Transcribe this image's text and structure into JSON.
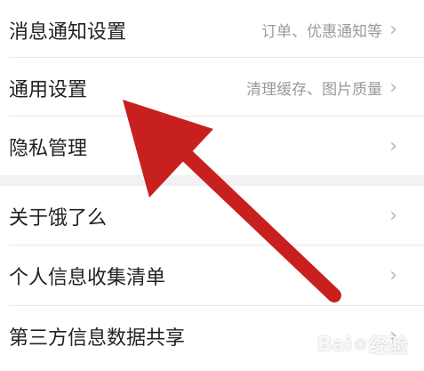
{
  "settings_group_1": [
    {
      "label": "消息通知设置",
      "hint": "订单、优惠通知等"
    },
    {
      "label": "通用设置",
      "hint": "清理缓存、图片质量"
    },
    {
      "label": "隐私管理",
      "hint": ""
    }
  ],
  "settings_group_2": [
    {
      "label": "关于饿了么",
      "hint": ""
    },
    {
      "label": "个人信息收集清单",
      "hint": ""
    },
    {
      "label": "第三方信息数据共享",
      "hint": ""
    }
  ],
  "chevron": "›",
  "watermark": {
    "brand": "Bai",
    "suffix": "经验"
  },
  "colors": {
    "arrow": "#c8201e",
    "text": "#222222",
    "hint": "#9a9a9a",
    "background": "#f2f2f2"
  },
  "icons": {
    "chevron": "chevron-right-icon",
    "arrow": "annotation-arrow"
  }
}
